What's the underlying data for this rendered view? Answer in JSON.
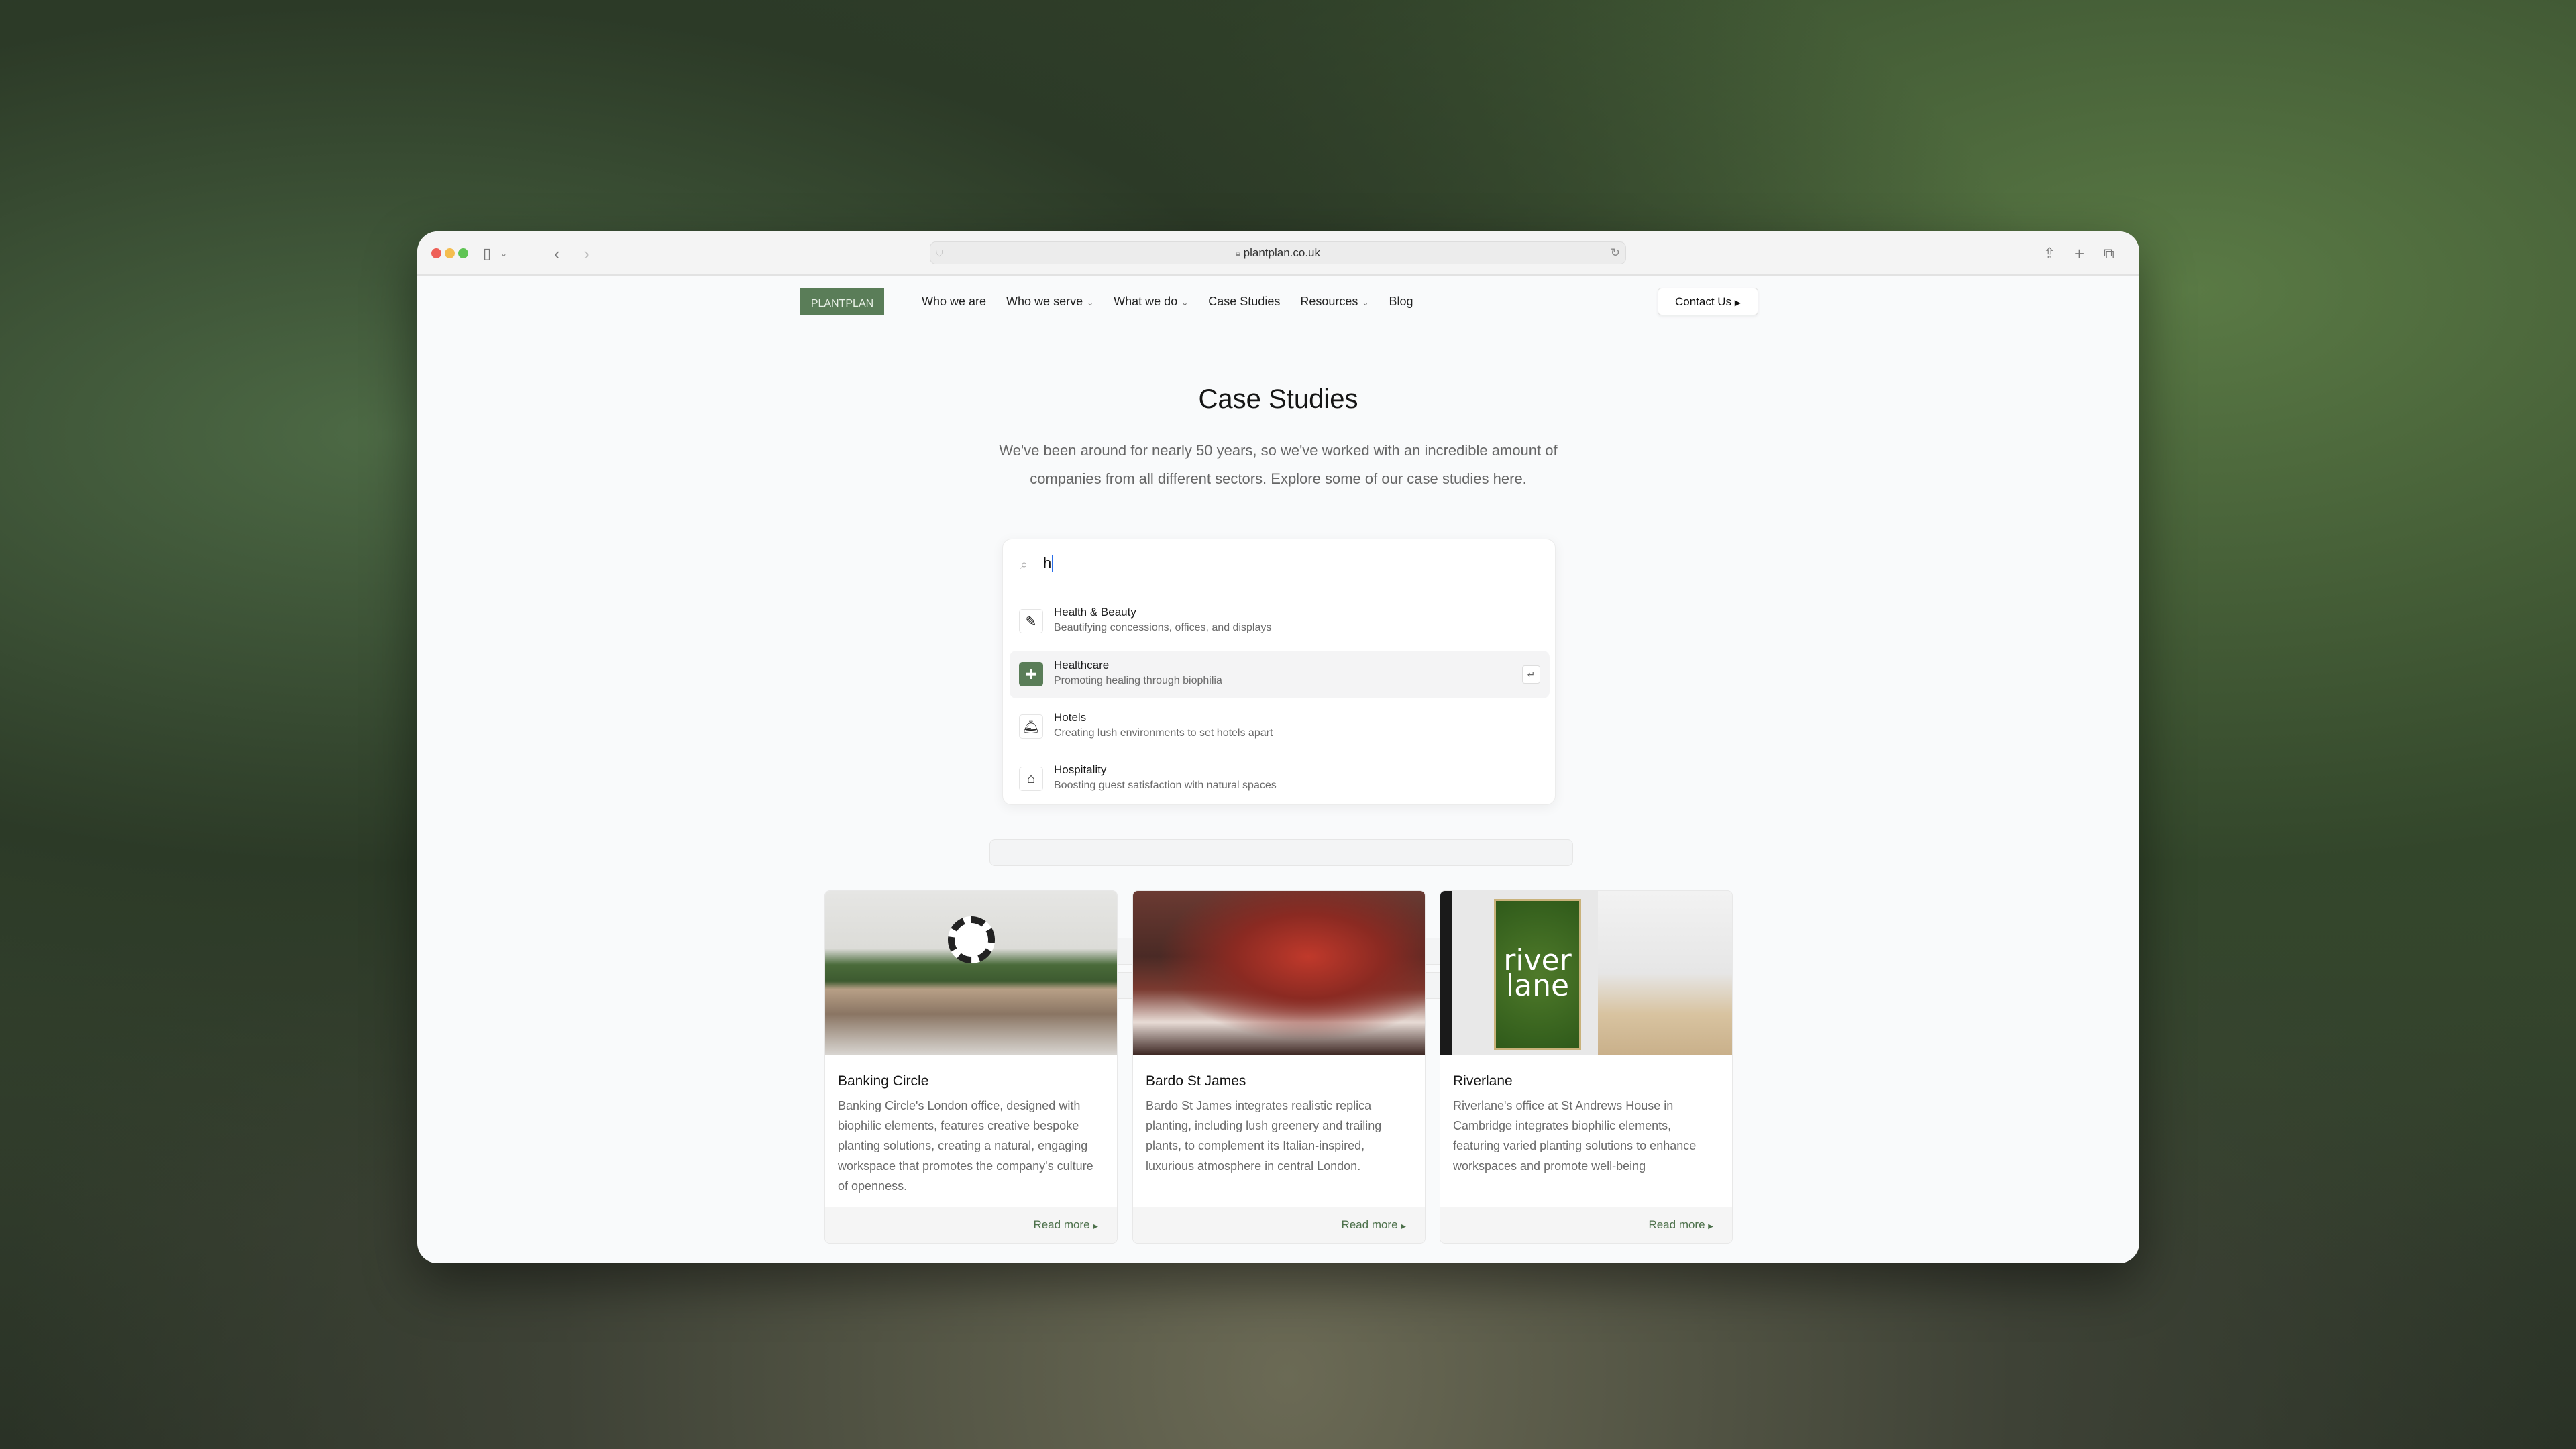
{
  "browser": {
    "url": "plantplan.co.uk"
  },
  "nav": {
    "logo": "PLANTPLAN",
    "items": [
      {
        "label": "Who we are",
        "dropdown": false
      },
      {
        "label": "Who we serve",
        "dropdown": true
      },
      {
        "label": "What we do",
        "dropdown": true
      },
      {
        "label": "Case Studies",
        "dropdown": false
      },
      {
        "label": "Resources",
        "dropdown": true
      },
      {
        "label": "Blog",
        "dropdown": false
      }
    ],
    "contact_label": "Contact Us"
  },
  "hero": {
    "title": "Case Studies",
    "subtitle_line1": "We've been around for nearly 50 years, so we've worked with an incredible amount of",
    "subtitle_line2": "companies from all different sectors. Explore some of our case studies here."
  },
  "search": {
    "value": "h",
    "results": [
      {
        "title": "Health & Beauty",
        "desc": "Beautifying concessions, offices, and displays",
        "icon": "brush-icon",
        "selected": false
      },
      {
        "title": "Healthcare",
        "desc": "Promoting healing through biophilia",
        "icon": "medical-cross-icon",
        "selected": true
      },
      {
        "title": "Hotels",
        "desc": "Creating lush environments to set hotels apart",
        "icon": "service-bell-icon",
        "selected": false
      },
      {
        "title": "Hospitality",
        "desc": "Boosting guest satisfaction with natural spaces",
        "icon": "cake-icon",
        "selected": false
      }
    ],
    "enter_hint": "↵"
  },
  "cards": [
    {
      "title": "Banking Circle",
      "desc": "Banking Circle's London office, designed with biophilic elements, features creative bespoke planting solutions, creating a natural, engaging workspace that promotes the company's culture of openness.",
      "link": "Read more"
    },
    {
      "title": "Bardo St James",
      "desc": "Bardo St James integrates realistic replica planting, including lush greenery and trailing plants, to complement its Italian-inspired, luxurious atmosphere in central London.",
      "link": "Read more"
    },
    {
      "title": "Riverlane",
      "desc": "Riverlane's office at St Andrews House in Cambridge integrates biophilic elements, featuring varied planting solutions to enhance workspaces and promote well-being",
      "link": "Read more",
      "image_text": "river lane"
    }
  ],
  "colors": {
    "brand": "#5a7d58",
    "link": "#4c704a"
  }
}
